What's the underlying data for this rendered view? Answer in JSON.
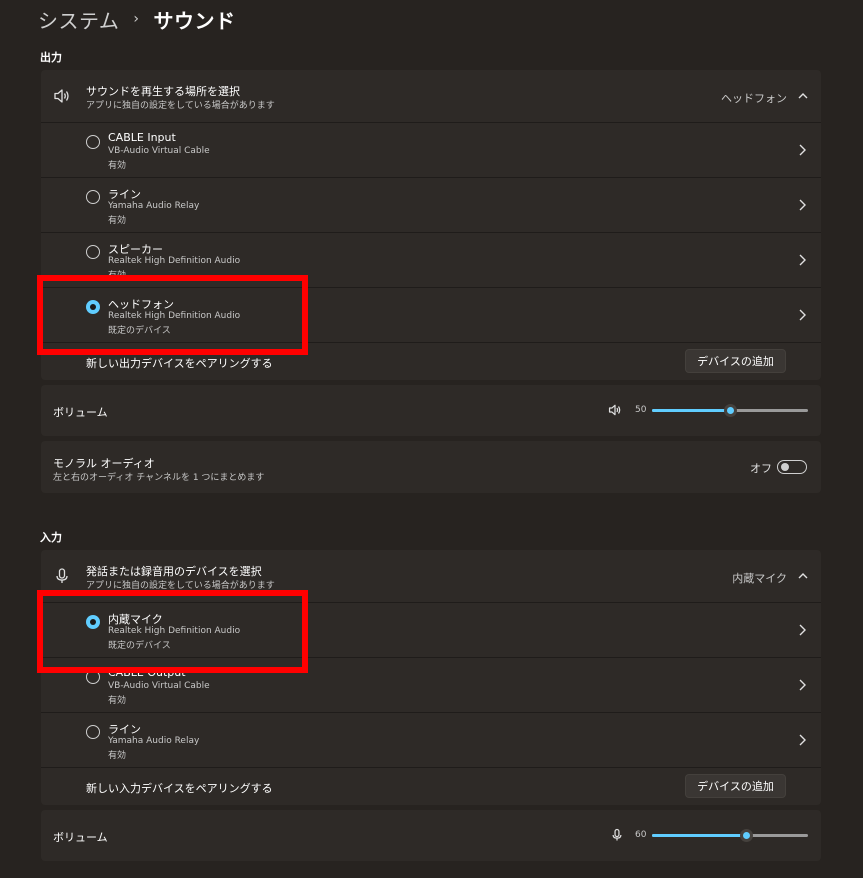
{
  "breadcrumb": {
    "parent": "システム",
    "separator": "›",
    "current": "サウンド"
  },
  "output": {
    "section_title": "出力",
    "selector": {
      "title": "サウンドを再生する場所を選択",
      "subtitle": "アプリに独自の設定をしている場合があります",
      "value": "ヘッドフォン"
    },
    "devices": [
      {
        "name": "CABLE Input",
        "driver": "VB-Audio Virtual Cable",
        "status": "有効",
        "selected": false
      },
      {
        "name": "ライン",
        "driver": "Yamaha Audio Relay",
        "status": "有効",
        "selected": false
      },
      {
        "name": "スピーカー",
        "driver": "Realtek High Definition Audio",
        "status": "有効",
        "selected": false
      },
      {
        "name": "ヘッドフォン",
        "driver": "Realtek High Definition Audio",
        "status": "既定のデバイス",
        "selected": true
      }
    ],
    "pair": {
      "label": "新しい出力デバイスをペアリングする",
      "button": "デバイスの追加"
    },
    "volume": {
      "label": "ボリューム",
      "value": "50",
      "level": 50
    },
    "mono": {
      "title": "モノラル オーディオ",
      "subtitle": "左と右のオーディオ チャンネルを 1 つにまとめます",
      "state": "オフ"
    }
  },
  "input": {
    "section_title": "入力",
    "selector": {
      "title": "発話または録音用のデバイスを選択",
      "subtitle": "アプリに独自の設定をしている場合があります",
      "value": "内蔵マイク"
    },
    "devices": [
      {
        "name": "内蔵マイク",
        "driver": "Realtek High Definition Audio",
        "status": "既定のデバイス",
        "selected": true
      },
      {
        "name": "CABLE Output",
        "driver": "VB-Audio Virtual Cable",
        "status": "有効",
        "selected": false
      },
      {
        "name": "ライン",
        "driver": "Yamaha Audio Relay",
        "status": "有効",
        "selected": false
      }
    ],
    "pair": {
      "label": "新しい入力デバイスをペアリングする",
      "button": "デバイスの追加"
    },
    "volume": {
      "label": "ボリューム",
      "value": "60",
      "level": 60
    }
  },
  "colors": {
    "accent": "#60cdff",
    "highlight": "#ff0000",
    "background": "#272320",
    "card": "#2e2a27"
  }
}
